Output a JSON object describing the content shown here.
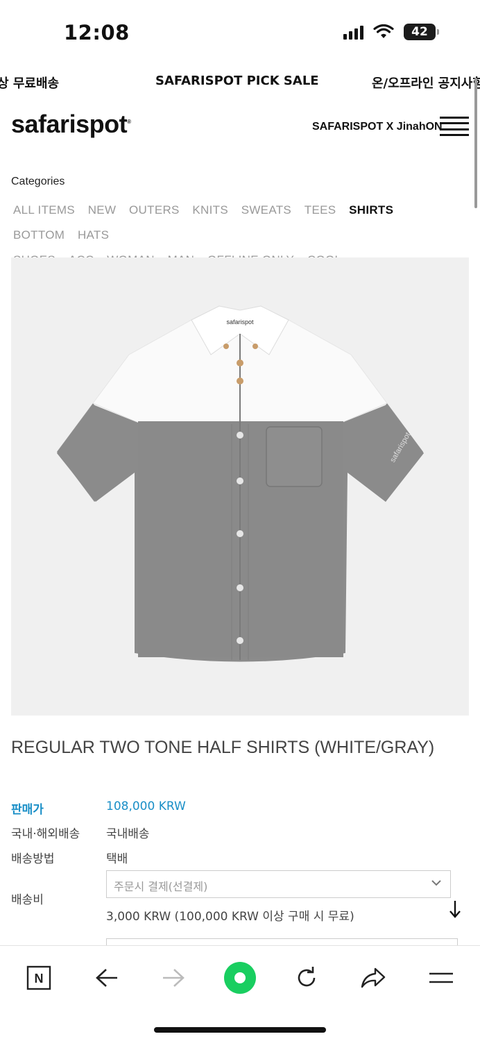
{
  "status": {
    "time": "12:08",
    "battery": "42"
  },
  "marquee": {
    "items": [
      "상 무료배송",
      "SAFARISPOT PICK SALE",
      "온/오프라인 공지사항"
    ]
  },
  "header": {
    "logo": "safarispot",
    "logo_mark": "®",
    "collab_link": "SAFARISPOT X JinahON"
  },
  "categories": {
    "title": "Categories",
    "items": [
      "ALL ITEMS",
      "NEW",
      "OUTERS",
      "KNITS",
      "SWEATS",
      "TEES",
      "SHIRTS",
      "BOTTOM",
      "HATS",
      "SHOES",
      "ACC",
      "WOMAN",
      "MAN",
      "OFFLINE ONLY",
      "COOL"
    ],
    "active": "SHIRTS"
  },
  "product": {
    "image_alt": "safarispot",
    "name": "REGULAR TWO TONE HALF SHIRTS (WHITE/GRAY)",
    "price_label": "판매가",
    "price_value": "108,000 KRW",
    "shipping_region_label": "국내·해외배송",
    "shipping_region_value": "국내배송",
    "shipping_method_label": "배송방법",
    "shipping_method_value": "택배",
    "shipping_fee_label": "배송비",
    "shipping_fee_select": "주문시 결제(선결제)",
    "shipping_fee_note": "3,000 KRW (100,000 KRW 이상 구매 시 무료)"
  },
  "colors": {
    "accent": "#1a8fc7",
    "browser_green": "#19ce60"
  },
  "toolbar": {
    "icons": [
      "naver-n-icon",
      "back-arrow-icon",
      "forward-arrow-icon",
      "green-dot-icon",
      "reload-icon",
      "share-icon",
      "menu-icon"
    ],
    "n_label": "N"
  }
}
